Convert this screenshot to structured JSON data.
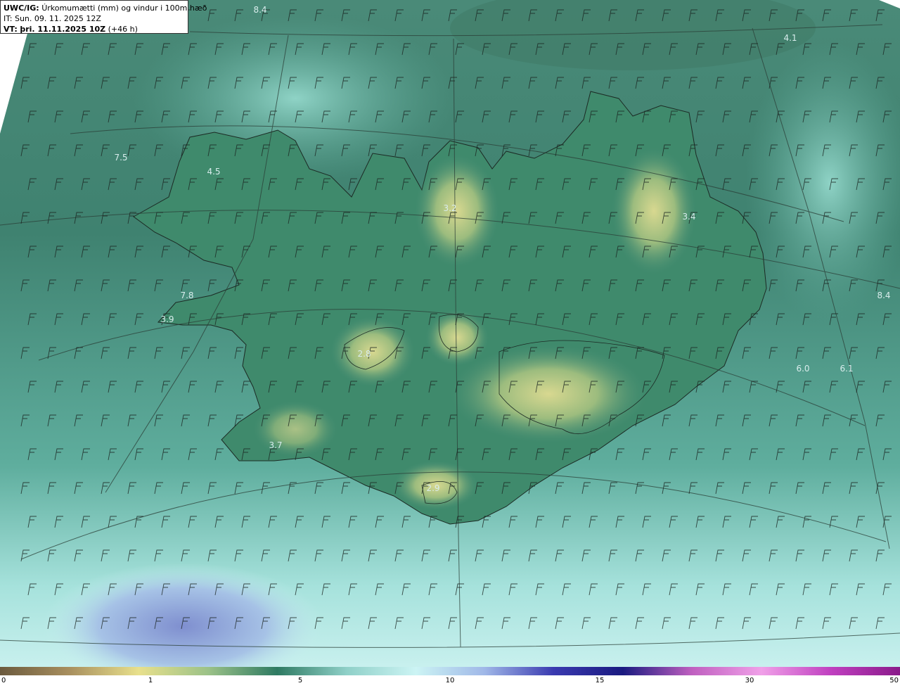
{
  "header": {
    "model_label": "UWC/IG:",
    "title": "Úrkomumætti (mm) og vindur i 100m hæð",
    "init_time": "IT: Sun. 09. 11. 2025 12Z",
    "valid_label": "VT:",
    "valid_time": "þri. 11.11.2025 10Z",
    "lead_time": "(+46 h)"
  },
  "map_labels": [
    "8.4",
    "4.1",
    "7.5",
    "4.5",
    "3.2",
    "3.4",
    "7.8",
    "3.9",
    "2.8",
    "8.4",
    "6.0",
    "6.1",
    "3.7",
    "2.9"
  ],
  "colorbar": {
    "ticks": [
      "0",
      "1",
      "5",
      "10",
      "15",
      "30",
      "50"
    ],
    "colors": [
      "#6b5a3e",
      "#a88f5e",
      "#e8e08c",
      "#9cc288",
      "#2e7a62",
      "#8fd0c8",
      "#ccf4f4",
      "#a0b8e8",
      "#3a3ab0",
      "#1a1a80",
      "#c060c0",
      "#f0a0e8",
      "#c040c0",
      "#8a1a8a"
    ]
  }
}
